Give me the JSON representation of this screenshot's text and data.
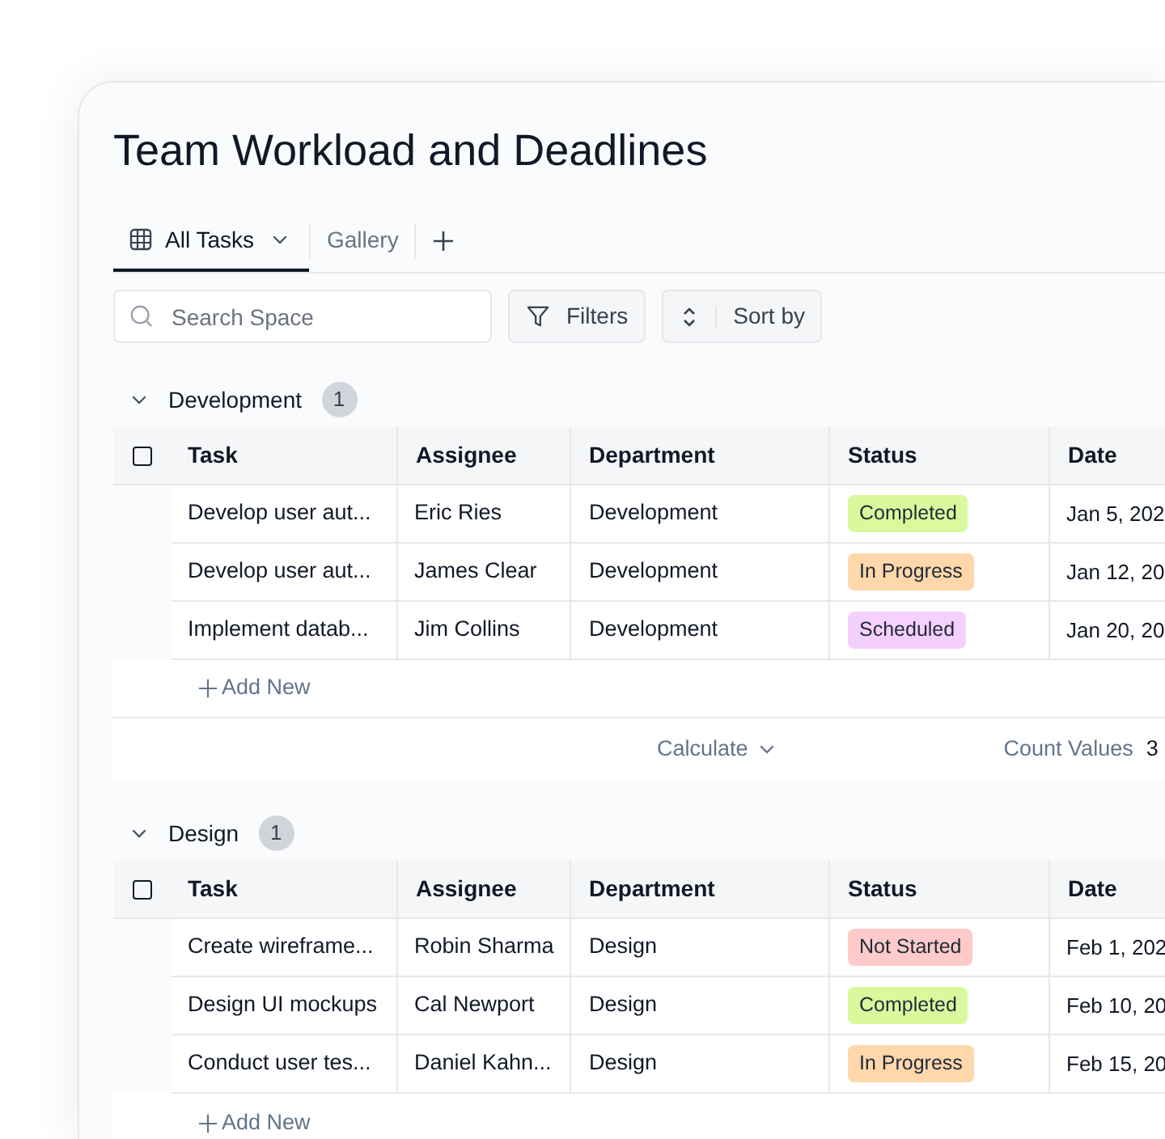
{
  "title": "Team Workload and Deadlines",
  "tabs": [
    {
      "label": "All Tasks",
      "kind": "table",
      "selected": true
    },
    {
      "label": "Gallery",
      "kind": "plain",
      "selected": false
    }
  ],
  "search": {
    "placeholder": "Search Space"
  },
  "toolbar": {
    "filters": "Filters",
    "sort": "Sort by"
  },
  "groups": [
    {
      "name": "Development",
      "columns": [
        "Task",
        "Assignee",
        "Department",
        "Status",
        "Date"
      ],
      "count": "1",
      "expanded": true,
      "all_checked": false,
      "add_label": "Add New",
      "footer": {
        "calculate": "Calculate",
        "count_label": "Count Values",
        "count": "3"
      },
      "rows": [
        {
          "task": "Develop user aut...",
          "assignee": "Eric Ries",
          "department": "Development",
          "status": "Completed",
          "color": "#d9f99d",
          "date": "Jan 5, 202"
        },
        {
          "task": "Develop user aut...",
          "assignee": "James Clear",
          "department": "Development",
          "status": "In Progress",
          "color": "#fed7aa",
          "date": "Jan 12, 20"
        },
        {
          "task": "Implement datab...",
          "assignee": "Jim Collins",
          "department": "Development",
          "status": "Scheduled",
          "color": "#f5d0fe",
          "date": "Jan 20, 20"
        }
      ]
    },
    {
      "name": "Design",
      "columns": [
        "Task",
        "Assignee",
        "Department",
        "Status",
        "Date"
      ],
      "count": "1",
      "expanded": true,
      "all_checked": false,
      "add_label": "Add New",
      "rows": [
        {
          "task": "Create wireframe...",
          "assignee": "Robin Sharma",
          "department": "Design",
          "status": "Not Started",
          "color": "#fecaca",
          "date": "Feb 1, 202"
        },
        {
          "task": "Design UI mockups",
          "assignee": "Cal Newport",
          "department": "Design",
          "status": "Completed",
          "color": "#d9f99d",
          "date": "Feb 10, 20"
        },
        {
          "task": "Conduct user tes...",
          "assignee": "Daniel Kahn...",
          "department": "Design",
          "status": "In Progress",
          "color": "#fed7aa",
          "date": "Feb 15, 20"
        }
      ]
    }
  ]
}
